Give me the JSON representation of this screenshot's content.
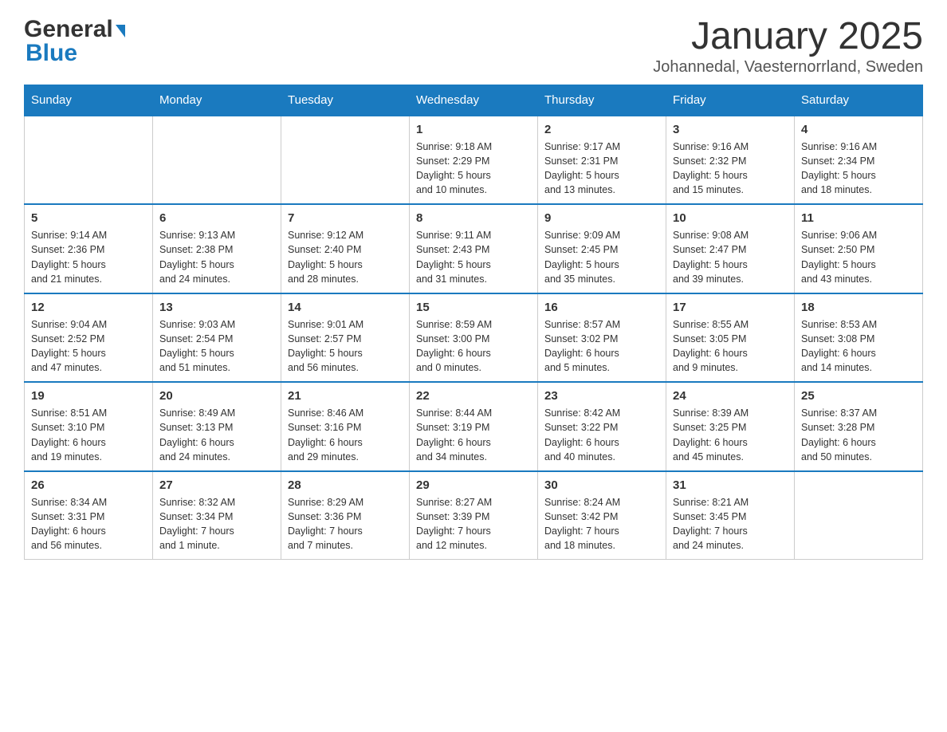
{
  "header": {
    "logo_general": "General",
    "logo_blue": "Blue",
    "title": "January 2025",
    "subtitle": "Johannedal, Vaesternorrland, Sweden"
  },
  "calendar": {
    "days_of_week": [
      "Sunday",
      "Monday",
      "Tuesday",
      "Wednesday",
      "Thursday",
      "Friday",
      "Saturday"
    ],
    "weeks": [
      [
        {
          "day": "",
          "info": ""
        },
        {
          "day": "",
          "info": ""
        },
        {
          "day": "",
          "info": ""
        },
        {
          "day": "1",
          "info": "Sunrise: 9:18 AM\nSunset: 2:29 PM\nDaylight: 5 hours\nand 10 minutes."
        },
        {
          "day": "2",
          "info": "Sunrise: 9:17 AM\nSunset: 2:31 PM\nDaylight: 5 hours\nand 13 minutes."
        },
        {
          "day": "3",
          "info": "Sunrise: 9:16 AM\nSunset: 2:32 PM\nDaylight: 5 hours\nand 15 minutes."
        },
        {
          "day": "4",
          "info": "Sunrise: 9:16 AM\nSunset: 2:34 PM\nDaylight: 5 hours\nand 18 minutes."
        }
      ],
      [
        {
          "day": "5",
          "info": "Sunrise: 9:14 AM\nSunset: 2:36 PM\nDaylight: 5 hours\nand 21 minutes."
        },
        {
          "day": "6",
          "info": "Sunrise: 9:13 AM\nSunset: 2:38 PM\nDaylight: 5 hours\nand 24 minutes."
        },
        {
          "day": "7",
          "info": "Sunrise: 9:12 AM\nSunset: 2:40 PM\nDaylight: 5 hours\nand 28 minutes."
        },
        {
          "day": "8",
          "info": "Sunrise: 9:11 AM\nSunset: 2:43 PM\nDaylight: 5 hours\nand 31 minutes."
        },
        {
          "day": "9",
          "info": "Sunrise: 9:09 AM\nSunset: 2:45 PM\nDaylight: 5 hours\nand 35 minutes."
        },
        {
          "day": "10",
          "info": "Sunrise: 9:08 AM\nSunset: 2:47 PM\nDaylight: 5 hours\nand 39 minutes."
        },
        {
          "day": "11",
          "info": "Sunrise: 9:06 AM\nSunset: 2:50 PM\nDaylight: 5 hours\nand 43 minutes."
        }
      ],
      [
        {
          "day": "12",
          "info": "Sunrise: 9:04 AM\nSunset: 2:52 PM\nDaylight: 5 hours\nand 47 minutes."
        },
        {
          "day": "13",
          "info": "Sunrise: 9:03 AM\nSunset: 2:54 PM\nDaylight: 5 hours\nand 51 minutes."
        },
        {
          "day": "14",
          "info": "Sunrise: 9:01 AM\nSunset: 2:57 PM\nDaylight: 5 hours\nand 56 minutes."
        },
        {
          "day": "15",
          "info": "Sunrise: 8:59 AM\nSunset: 3:00 PM\nDaylight: 6 hours\nand 0 minutes."
        },
        {
          "day": "16",
          "info": "Sunrise: 8:57 AM\nSunset: 3:02 PM\nDaylight: 6 hours\nand 5 minutes."
        },
        {
          "day": "17",
          "info": "Sunrise: 8:55 AM\nSunset: 3:05 PM\nDaylight: 6 hours\nand 9 minutes."
        },
        {
          "day": "18",
          "info": "Sunrise: 8:53 AM\nSunset: 3:08 PM\nDaylight: 6 hours\nand 14 minutes."
        }
      ],
      [
        {
          "day": "19",
          "info": "Sunrise: 8:51 AM\nSunset: 3:10 PM\nDaylight: 6 hours\nand 19 minutes."
        },
        {
          "day": "20",
          "info": "Sunrise: 8:49 AM\nSunset: 3:13 PM\nDaylight: 6 hours\nand 24 minutes."
        },
        {
          "day": "21",
          "info": "Sunrise: 8:46 AM\nSunset: 3:16 PM\nDaylight: 6 hours\nand 29 minutes."
        },
        {
          "day": "22",
          "info": "Sunrise: 8:44 AM\nSunset: 3:19 PM\nDaylight: 6 hours\nand 34 minutes."
        },
        {
          "day": "23",
          "info": "Sunrise: 8:42 AM\nSunset: 3:22 PM\nDaylight: 6 hours\nand 40 minutes."
        },
        {
          "day": "24",
          "info": "Sunrise: 8:39 AM\nSunset: 3:25 PM\nDaylight: 6 hours\nand 45 minutes."
        },
        {
          "day": "25",
          "info": "Sunrise: 8:37 AM\nSunset: 3:28 PM\nDaylight: 6 hours\nand 50 minutes."
        }
      ],
      [
        {
          "day": "26",
          "info": "Sunrise: 8:34 AM\nSunset: 3:31 PM\nDaylight: 6 hours\nand 56 minutes."
        },
        {
          "day": "27",
          "info": "Sunrise: 8:32 AM\nSunset: 3:34 PM\nDaylight: 7 hours\nand 1 minute."
        },
        {
          "day": "28",
          "info": "Sunrise: 8:29 AM\nSunset: 3:36 PM\nDaylight: 7 hours\nand 7 minutes."
        },
        {
          "day": "29",
          "info": "Sunrise: 8:27 AM\nSunset: 3:39 PM\nDaylight: 7 hours\nand 12 minutes."
        },
        {
          "day": "30",
          "info": "Sunrise: 8:24 AM\nSunset: 3:42 PM\nDaylight: 7 hours\nand 18 minutes."
        },
        {
          "day": "31",
          "info": "Sunrise: 8:21 AM\nSunset: 3:45 PM\nDaylight: 7 hours\nand 24 minutes."
        },
        {
          "day": "",
          "info": ""
        }
      ]
    ]
  }
}
